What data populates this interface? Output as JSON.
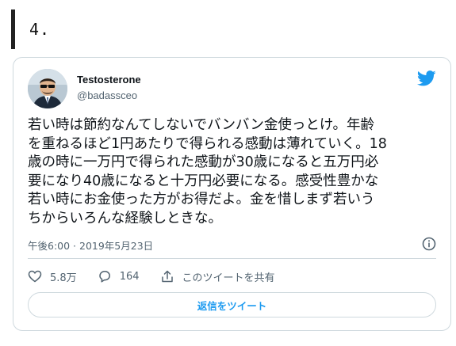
{
  "heading": {
    "number": "4."
  },
  "tweet": {
    "author_name": "Testosterone",
    "author_handle": "@badassceo",
    "text": "若い時は節約なんてしないでバンバン金使っとけ。年齢\nを重ねるほど1円あたりで得られる感動は薄れていく。18\n歳の時に一万円で得られた感動が30歳になると五万円必\n要になり40歳になると十万円必要になる。感受性豊かな\n若い時にお金使った方がお得だよ。金を惜しまず若いう\nちからいろんな経験しときな。",
    "timestamp": "午後6:00 · 2019年5月23日",
    "likes": "5.8万",
    "replies": "164",
    "share_label": "このツイートを共有",
    "reply_button_label": "返信をツイート"
  },
  "icons": {
    "brand": "twitter-bird-icon",
    "info": "info-icon",
    "like": "heart-icon",
    "reply": "comment-icon",
    "share": "share-icon"
  },
  "colors": {
    "accent": "#1d9bf0",
    "text": "#0f1419",
    "muted": "#536471",
    "border": "#cfd9de"
  }
}
